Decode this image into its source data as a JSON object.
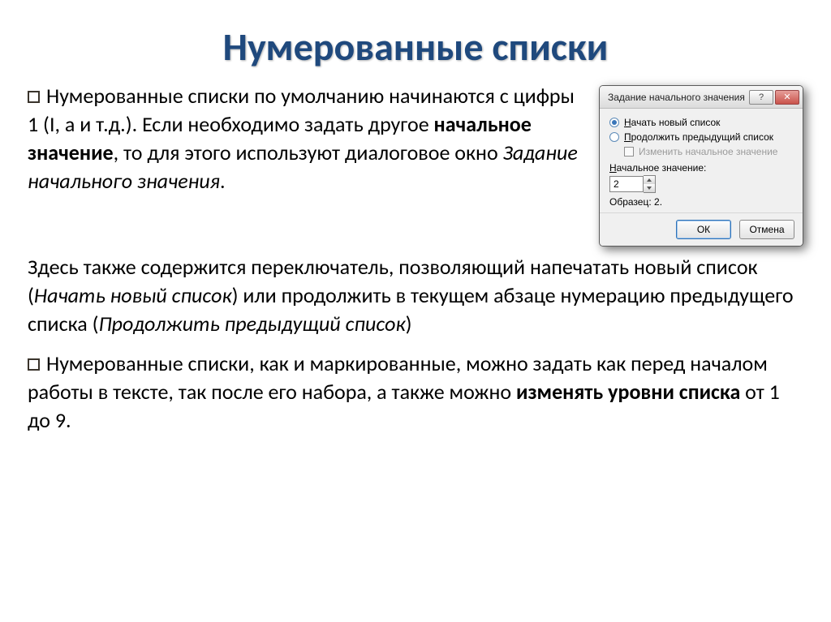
{
  "title": "Нумерованные списки",
  "para1": {
    "a": "Нумерованные списки по умолчанию начинаются с цифры 1 (I, а и т.д.). Если необходимо задать другое ",
    "b": "начальное значение",
    "c": ", то для этого используют диалоговое окно ",
    "d": "Задание начального значения",
    "e": "."
  },
  "para2": {
    "a": "Здесь  также содержится переключатель, позволяющий напечатать новый список (",
    "b": "Начать новый список",
    "c": ") или продолжить в текущем абзаце нумерацию предыдущего списка (",
    "d": "Продолжить предыдущий список",
    "e": ")"
  },
  "para3": {
    "a": "Нумерованные списки, как и маркированные, можно задать как перед началом работы в тексте, так после его набора, а также можно ",
    "b": "изменять уровни списка",
    "c": " от 1 до 9."
  },
  "dialog": {
    "title": "Задание начального значения",
    "radio_new": "ачать новый список",
    "radio_new_u": "Н",
    "radio_continue": "родолжить предыдущий список",
    "radio_continue_u": "П",
    "checkbox_label": "Изменить начальное значение",
    "value_label_u": "Н",
    "value_label": "ачальное значение:",
    "value": "2",
    "sample_label": "Образец: ",
    "sample_value": "2.",
    "ok": "ОК",
    "cancel": "Отмена",
    "help_icon": "?",
    "close_icon": "✕"
  }
}
